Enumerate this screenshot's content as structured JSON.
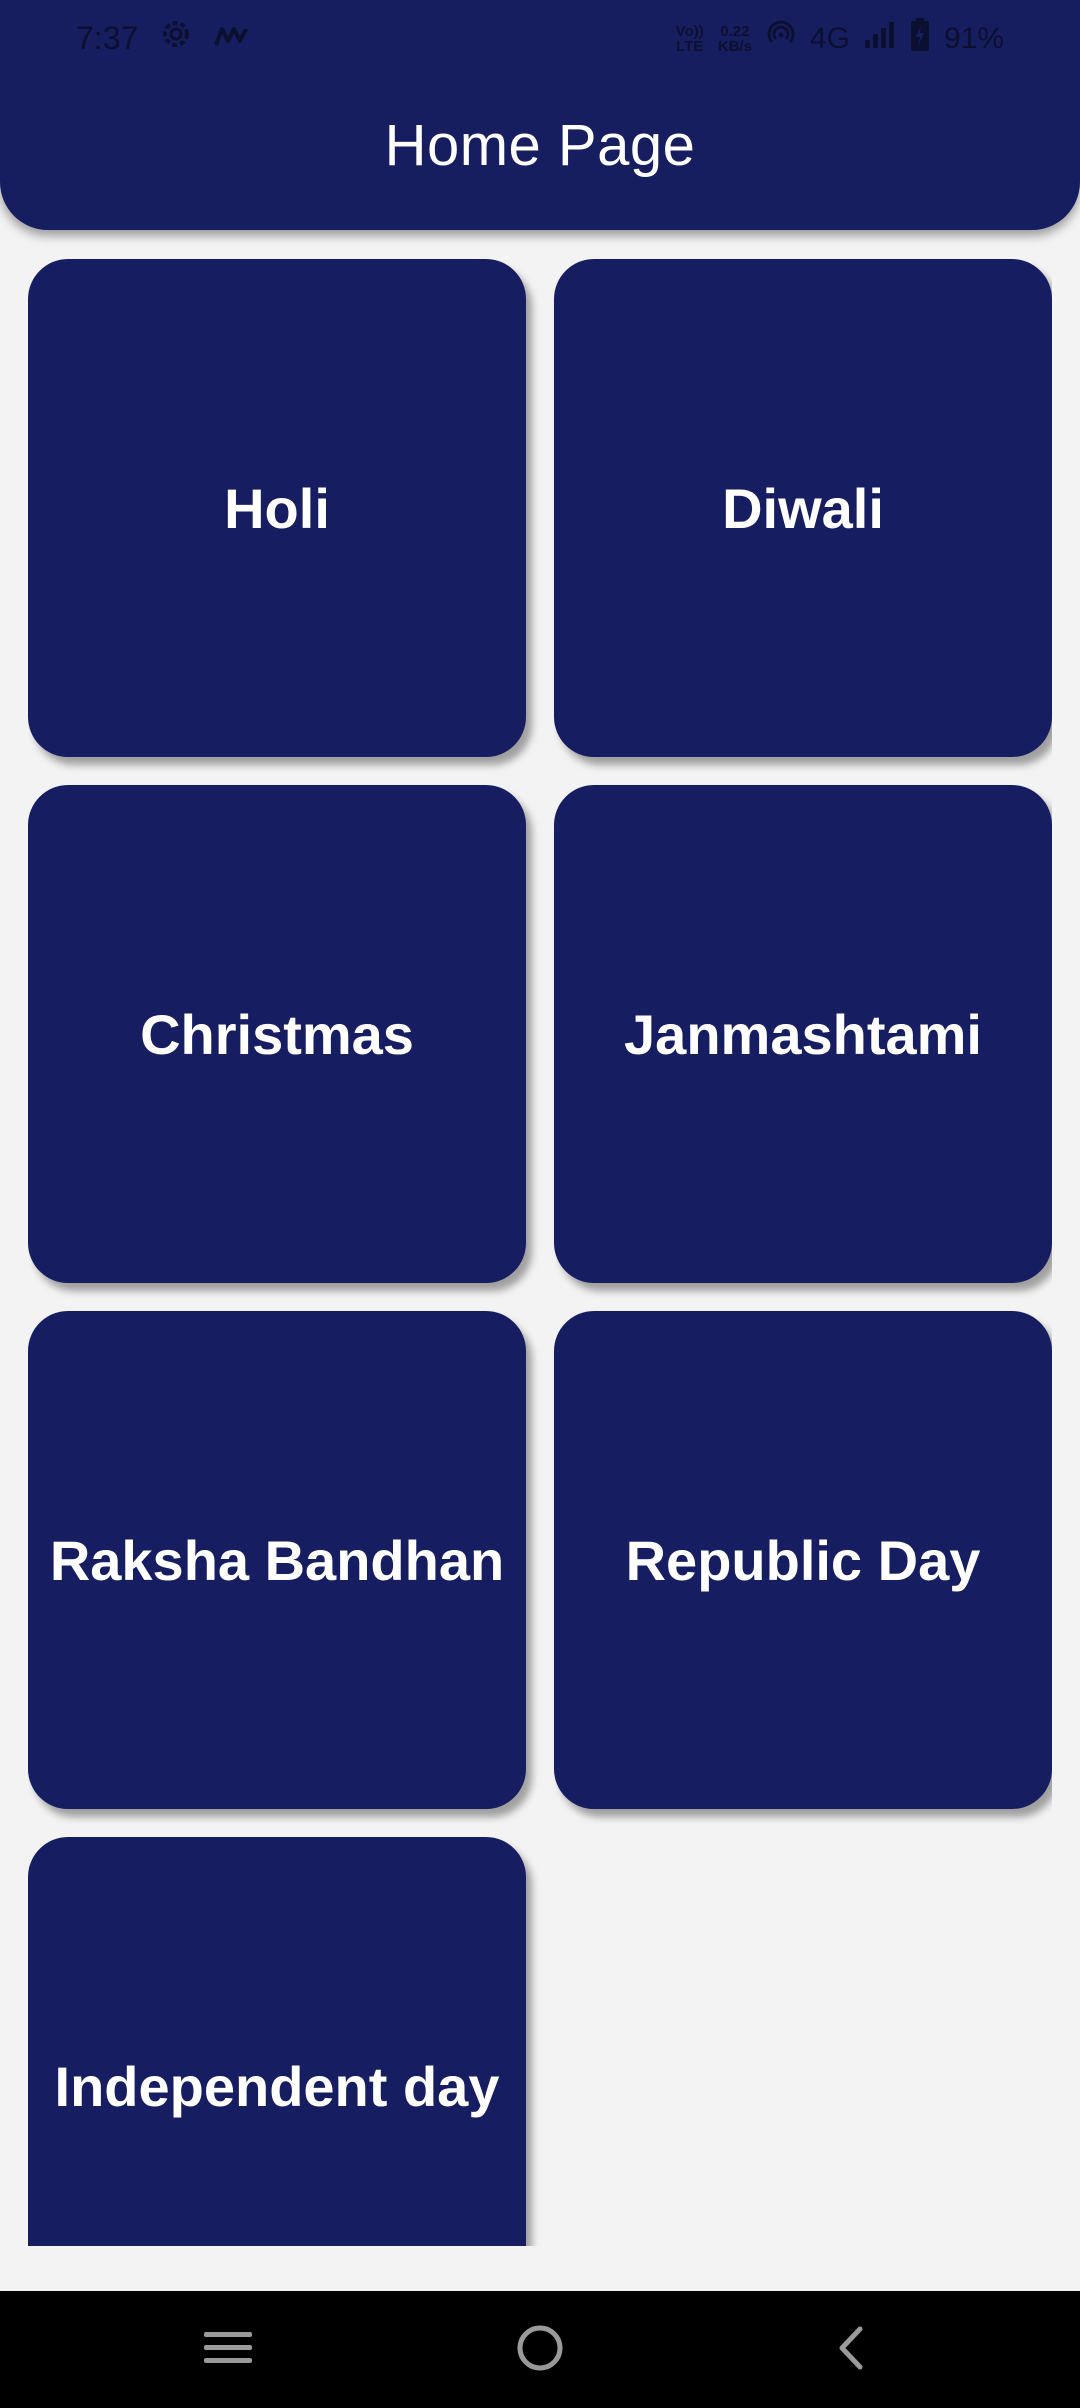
{
  "status_bar": {
    "time": "7:37",
    "volte_top": "Vo))",
    "volte_bottom": "LTE",
    "speed_value": "0.22",
    "speed_unit": "KB/s",
    "network": "4G",
    "battery": "91%"
  },
  "header": {
    "title": "Home Page"
  },
  "festivals": [
    {
      "label": "Holi"
    },
    {
      "label": "Diwali"
    },
    {
      "label": "Christmas"
    },
    {
      "label": "Janmashtami"
    },
    {
      "label": "Raksha Bandhan"
    },
    {
      "label": "Republic Day"
    },
    {
      "label": "Independent day"
    }
  ],
  "colors": {
    "primary": "#171e60",
    "background": "#f3f3f3",
    "tile_text": "#ffffff",
    "nav_bar": "#000000"
  },
  "nav_bar": {
    "icons": [
      "menu-icon",
      "home-circle-icon",
      "back-icon"
    ]
  }
}
